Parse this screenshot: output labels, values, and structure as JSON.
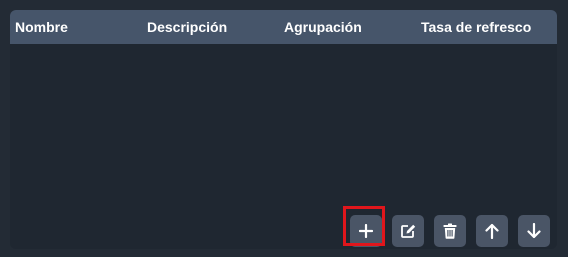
{
  "table": {
    "columns": [
      {
        "label": "Nombre"
      },
      {
        "label": "Descripción"
      },
      {
        "label": "Agrupación"
      },
      {
        "label": "Tasa de refresco"
      }
    ],
    "rows": []
  },
  "toolbar": {
    "buttons": [
      {
        "name": "add-button",
        "icon": "plus-icon"
      },
      {
        "name": "edit-button",
        "icon": "edit-icon"
      },
      {
        "name": "delete-button",
        "icon": "trash-icon"
      },
      {
        "name": "move-up-button",
        "icon": "arrow-up-icon"
      },
      {
        "name": "move-down-button",
        "icon": "arrow-down-icon"
      }
    ]
  },
  "highlight": {
    "target": "add-button",
    "color": "#e0161c"
  },
  "colors": {
    "page_background": "#232b35",
    "panel_background": "#1f2731",
    "header_background": "#46556a",
    "button_background": "#4a5566",
    "icon_color": "#ffffff"
  }
}
